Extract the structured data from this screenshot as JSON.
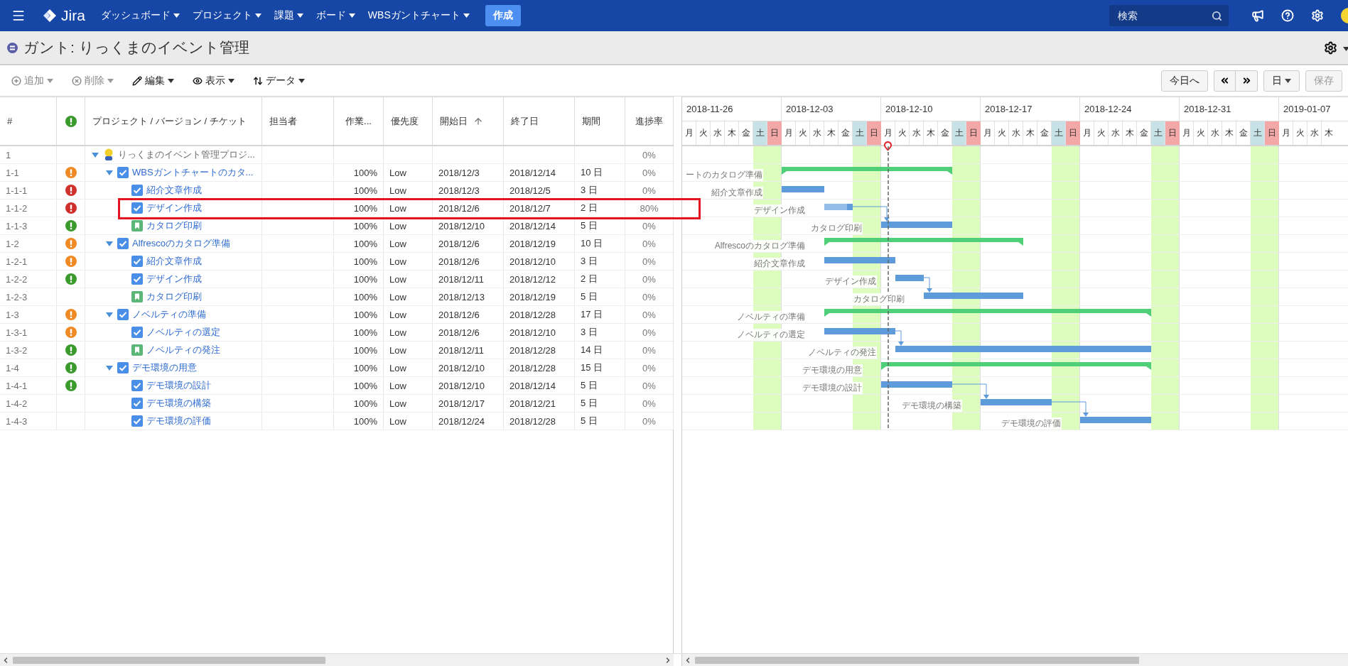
{
  "nav": {
    "logo": "Jira",
    "menus": [
      {
        "label": "ダッシュボード"
      },
      {
        "label": "プロジェクト"
      },
      {
        "label": "課題"
      },
      {
        "label": "ボード"
      },
      {
        "label": "WBSガントチャート"
      }
    ],
    "create_button": "作成",
    "search": {
      "placeholder": "検索"
    }
  },
  "page": {
    "title": "ガント: りっくまのイベント管理"
  },
  "toolbar": {
    "actions": [
      {
        "kind": "add",
        "label": "追加",
        "disabled": true
      },
      {
        "kind": "delete",
        "label": "削除",
        "disabled": true
      },
      {
        "kind": "edit",
        "label": "編集",
        "disabled": false
      },
      {
        "kind": "view",
        "label": "表示",
        "disabled": false
      },
      {
        "kind": "data",
        "label": "データ",
        "disabled": false
      }
    ],
    "today_button": "今日へ",
    "scale_button": "日",
    "save_button": {
      "label": "保存",
      "disabled": true
    }
  },
  "table": {
    "columns": [
      {
        "kind": "text",
        "label": "#",
        "sorted": false
      },
      {
        "kind": "alert",
        "sorted": false
      },
      {
        "kind": "text",
        "label": "プロジェクト / バージョン / チケット",
        "sorted": false
      },
      {
        "kind": "text",
        "label": "担当者",
        "sorted": false
      },
      {
        "kind": "text",
        "label": "作業...",
        "sorted": false
      },
      {
        "kind": "text",
        "label": "優先度",
        "sorted": false
      },
      {
        "kind": "text",
        "label": "開始日",
        "sorted": true
      },
      {
        "kind": "text",
        "label": "終了日",
        "sorted": false
      },
      {
        "kind": "text",
        "label": "期間",
        "sorted": false
      },
      {
        "kind": "text",
        "label": "進捗率",
        "sorted": false
      }
    ],
    "rows": [
      {
        "number": "1",
        "kind": "project",
        "name": "りっくまのイベント管理プロジ...",
        "progress": "0%",
        "expanded": true,
        "highlighted": false,
        "linked": false,
        "children": [
          {
            "number": "1-1",
            "kind": "task",
            "color": "#f08a24",
            "name": "WBSガントチャートのカタ...",
            "work": "100%",
            "priority": "Low",
            "start": "2018/12/3",
            "end": "2018/12/14",
            "duration": "10 日",
            "progress": "0%",
            "gantt_label": "ートのカタログ準備",
            "expanded": true,
            "highlighted": false,
            "linked": false,
            "children": [
              {
                "number": "1-1-1",
                "kind": "task",
                "color": "#d0302b",
                "name": "紹介文章作成",
                "work": "100%",
                "priority": "Low",
                "start": "2018/12/3",
                "end": "2018/12/5",
                "duration": "3 日",
                "progress": "0%",
                "gantt_label": "紹介文章作成",
                "highlighted": false,
                "linked": false
              },
              {
                "number": "1-1-2",
                "kind": "task",
                "color": "#d0302b",
                "name": "デザイン作成",
                "work": "100%",
                "priority": "Low",
                "start": "2018/12/6",
                "end": "2018/12/7",
                "duration": "2 日",
                "progress": "80%",
                "level": 0.8,
                "gantt_label": "デザイン作成",
                "highlighted": true,
                "linked": false
              },
              {
                "number": "1-1-3",
                "kind": "story",
                "color": "#3a9a2c",
                "name": "カタログ印刷",
                "work": "100%",
                "priority": "Low",
                "start": "2018/12/10",
                "end": "2018/12/14",
                "duration": "5 日",
                "progress": "0%",
                "gantt_label": "カタログ印刷",
                "highlighted": false,
                "linked": true
              }
            ]
          },
          {
            "number": "1-2",
            "kind": "task",
            "color": "#f08a24",
            "name": "Alfrescoのカタログ準備",
            "work": "100%",
            "priority": "Low",
            "start": "2018/12/6",
            "end": "2018/12/19",
            "duration": "10 日",
            "progress": "0%",
            "gantt_label": "Alfrescoのカタログ準備",
            "expanded": true,
            "highlighted": false,
            "linked": false,
            "children": [
              {
                "number": "1-2-1",
                "kind": "task",
                "color": "#f08a24",
                "name": "紹介文章作成",
                "work": "100%",
                "priority": "Low",
                "start": "2018/12/6",
                "end": "2018/12/10",
                "duration": "3 日",
                "progress": "0%",
                "gantt_label": "紹介文章作成",
                "highlighted": false,
                "linked": false
              },
              {
                "number": "1-2-2",
                "kind": "task",
                "color": "#3a9a2c",
                "name": "デザイン作成",
                "work": "100%",
                "priority": "Low",
                "start": "2018/12/11",
                "end": "2018/12/12",
                "duration": "2 日",
                "progress": "0%",
                "gantt_label": "デザイン作成",
                "highlighted": false,
                "linked": false
              },
              {
                "number": "1-2-3",
                "kind": "story",
                "name": "カタログ印刷",
                "work": "100%",
                "priority": "Low",
                "start": "2018/12/13",
                "end": "2018/12/19",
                "duration": "5 日",
                "progress": "0%",
                "gantt_label": "カタログ印刷",
                "highlighted": false,
                "linked": true
              }
            ]
          },
          {
            "number": "1-3",
            "kind": "task",
            "color": "#f08a24",
            "name": "ノベルティの準備",
            "work": "100%",
            "priority": "Low",
            "start": "2018/12/6",
            "end": "2018/12/28",
            "duration": "17 日",
            "progress": "0%",
            "gantt_label": "ノベルティの準備",
            "expanded": true,
            "highlighted": false,
            "linked": false,
            "children": [
              {
                "number": "1-3-1",
                "kind": "task",
                "color": "#f08a24",
                "name": "ノベルティの選定",
                "work": "100%",
                "priority": "Low",
                "start": "2018/12/6",
                "end": "2018/12/10",
                "duration": "3 日",
                "progress": "0%",
                "gantt_label": "ノベルティの選定",
                "highlighted": false,
                "linked": false
              },
              {
                "number": "1-3-2",
                "kind": "story",
                "color": "#3a9a2c",
                "name": "ノベルティの発注",
                "work": "100%",
                "priority": "Low",
                "start": "2018/12/11",
                "end": "2018/12/28",
                "duration": "14 日",
                "progress": "0%",
                "gantt_label": "ノベルティの発注",
                "highlighted": false,
                "linked": true
              }
            ]
          },
          {
            "number": "1-4",
            "kind": "task",
            "color": "#3a9a2c",
            "name": "デモ環境の用意",
            "work": "100%",
            "priority": "Low",
            "start": "2018/12/10",
            "end": "2018/12/28",
            "duration": "15 日",
            "progress": "0%",
            "gantt_label": "デモ環境の用意",
            "expanded": true,
            "highlighted": false,
            "linked": false,
            "children": [
              {
                "number": "1-4-1",
                "kind": "task",
                "color": "#3a9a2c",
                "name": "デモ環境の設計",
                "work": "100%",
                "priority": "Low",
                "start": "2018/12/10",
                "end": "2018/12/14",
                "duration": "5 日",
                "progress": "0%",
                "gantt_label": "デモ環境の設計",
                "highlighted": false,
                "linked": false
              },
              {
                "number": "1-4-2",
                "kind": "task",
                "name": "デモ環境の構築",
                "work": "100%",
                "priority": "Low",
                "start": "2018/12/17",
                "end": "2018/12/21",
                "duration": "5 日",
                "progress": "0%",
                "gantt_label": "デモ環境の構築",
                "highlighted": false,
                "linked": true
              },
              {
                "number": "1-4-3",
                "kind": "task",
                "name": "デモ環境の評価",
                "work": "100%",
                "priority": "Low",
                "start": "2018/12/24",
                "end": "2018/12/28",
                "duration": "5 日",
                "progress": "0%",
                "gantt_label": "デモ環境の評価",
                "highlighted": false,
                "linked": true
              }
            ]
          }
        ]
      }
    ]
  },
  "gantt": {
    "weeks": [
      {
        "label": "2018-11-26",
        "days": [
          {
            "label": "月",
            "kind": "weekday",
            "today": false
          },
          {
            "label": "火",
            "kind": "weekday",
            "today": false
          },
          {
            "label": "水",
            "kind": "weekday",
            "today": false
          },
          {
            "label": "木",
            "kind": "weekday",
            "today": false
          },
          {
            "label": "金",
            "kind": "weekday",
            "today": false
          },
          {
            "label": "土",
            "kind": "saturday",
            "today": false
          },
          {
            "label": "日",
            "kind": "sunday",
            "today": false
          }
        ]
      },
      {
        "label": "2018-12-03",
        "days": [
          {
            "label": "月",
            "kind": "weekday",
            "today": false
          },
          {
            "label": "火",
            "kind": "weekday",
            "today": false
          },
          {
            "label": "水",
            "kind": "weekday",
            "today": false
          },
          {
            "label": "木",
            "kind": "weekday",
            "today": false
          },
          {
            "label": "金",
            "kind": "weekday",
            "today": false
          },
          {
            "label": "土",
            "kind": "saturday",
            "today": false
          },
          {
            "label": "日",
            "kind": "sunday",
            "today": false
          }
        ]
      },
      {
        "label": "2018-12-10",
        "days": [
          {
            "label": "月",
            "kind": "weekday",
            "today": true
          },
          {
            "label": "火",
            "kind": "weekday",
            "today": false
          },
          {
            "label": "水",
            "kind": "weekday",
            "today": false
          },
          {
            "label": "木",
            "kind": "weekday",
            "today": false
          },
          {
            "label": "金",
            "kind": "weekday",
            "today": false
          },
          {
            "label": "土",
            "kind": "saturday",
            "today": false
          },
          {
            "label": "日",
            "kind": "sunday",
            "today": false
          }
        ]
      },
      {
        "label": "2018-12-17",
        "days": [
          {
            "label": "月",
            "kind": "weekday",
            "today": false
          },
          {
            "label": "火",
            "kind": "weekday",
            "today": false
          },
          {
            "label": "水",
            "kind": "weekday",
            "today": false
          },
          {
            "label": "木",
            "kind": "weekday",
            "today": false
          },
          {
            "label": "金",
            "kind": "weekday",
            "today": false
          },
          {
            "label": "土",
            "kind": "saturday",
            "today": false
          },
          {
            "label": "日",
            "kind": "sunday",
            "today": false
          }
        ]
      },
      {
        "label": "2018-12-24",
        "days": [
          {
            "label": "月",
            "kind": "weekday",
            "today": false
          },
          {
            "label": "火",
            "kind": "weekday",
            "today": false
          },
          {
            "label": "水",
            "kind": "weekday",
            "today": false
          },
          {
            "label": "木",
            "kind": "weekday",
            "today": false
          },
          {
            "label": "金",
            "kind": "weekday",
            "today": false
          },
          {
            "label": "土",
            "kind": "saturday",
            "today": false
          },
          {
            "label": "日",
            "kind": "sunday",
            "today": false
          }
        ]
      },
      {
        "label": "2018-12-31",
        "days": [
          {
            "label": "月",
            "kind": "weekday",
            "today": false
          },
          {
            "label": "火",
            "kind": "weekday",
            "today": false
          },
          {
            "label": "水",
            "kind": "weekday",
            "today": false
          },
          {
            "label": "木",
            "kind": "weekday",
            "today": false
          },
          {
            "label": "金",
            "kind": "weekday",
            "today": false
          },
          {
            "label": "土",
            "kind": "saturday",
            "today": false
          },
          {
            "label": "日",
            "kind": "sunday",
            "today": false
          }
        ]
      },
      {
        "label": "2019-01-07",
        "days": [
          {
            "label": "月",
            "kind": "weekday",
            "today": false
          },
          {
            "label": "火",
            "kind": "weekday",
            "today": false
          },
          {
            "label": "水",
            "kind": "weekday",
            "today": false
          },
          {
            "label": "木",
            "kind": "weekday",
            "today": false
          }
        ]
      }
    ]
  }
}
